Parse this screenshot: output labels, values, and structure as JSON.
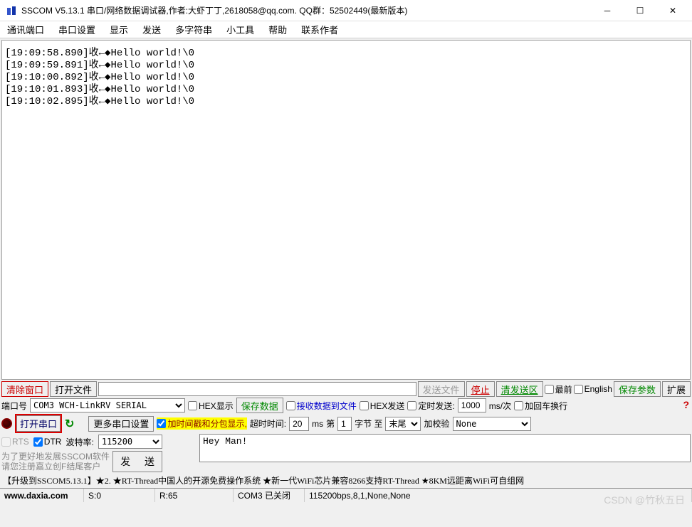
{
  "title": "SSCOM V5.13.1 串口/网络数据调试器,作者:大虾丁丁,2618058@qq.com. QQ群：52502449(最新版本)",
  "menu": [
    "通讯端口",
    "串口设置",
    "显示",
    "发送",
    "多字符串",
    "小工具",
    "帮助",
    "联系作者"
  ],
  "log_lines": [
    "[19:09:58.890]收←◆Hello world!\\0",
    "[19:09:59.891]收←◆Hello world!\\0",
    "[19:10:00.892]收←◆Hello world!\\0",
    "[19:10:01.893]收←◆Hello world!\\0",
    "[19:10:02.895]收←◆Hello world!\\0"
  ],
  "tb1": {
    "clear_win": "清除窗口",
    "open_file": "打开文件",
    "send_file": "发送文件",
    "stop": "停止",
    "clear_send": "清发送区",
    "topmost": "最前",
    "english": "English",
    "save_params": "保存参数",
    "expand": "扩展"
  },
  "row2": {
    "port_label": "端口号",
    "port_value": "COM3 WCH-LinkRV SERIAL",
    "hex_disp": "HEX显示",
    "save_data": "保存数据",
    "recv_to_file": "接收数据到文件",
    "hex_send": "HEX发送",
    "timed_send": "定时发送:",
    "timed_val": "1000",
    "timed_unit": "ms/次",
    "add_crlf": "加回车换行"
  },
  "row3": {
    "open_port": "打开串口",
    "more_settings": "更多串口设置",
    "timestamp": "加时间戳和分包显示,",
    "timeout_label": "超时时间:",
    "timeout_val": "20",
    "ms": "ms",
    "nth_label": "第",
    "nth_val": "1",
    "byte_to": "字节 至",
    "end_val": "末尾",
    "add_check": "加校验",
    "check_val": "None"
  },
  "row4": {
    "rts": "RTS",
    "dtr": "DTR",
    "baud_label": "波特率:",
    "baud_val": "115200",
    "grey1": "为了更好地发展SSCOM软件",
    "grey2": "请您注册嘉立创F结尾客户",
    "send": "发 送",
    "tx_val": "Hey Man!"
  },
  "ad": "【升级到SSCOM5.13.1】★2. ★RT-Thread中国人的开源免费操作系统 ★新一代WiFi芯片兼容8266支持RT-Thread ★8KM远距离WiFi可自组网",
  "status": {
    "url": "www.daxia.com",
    "s": "S:0",
    "r": "R:65",
    "port": "COM3 已关闭",
    "cfg": "115200bps,8,1,None,None"
  },
  "watermark": "CSDN @竹秋五日"
}
